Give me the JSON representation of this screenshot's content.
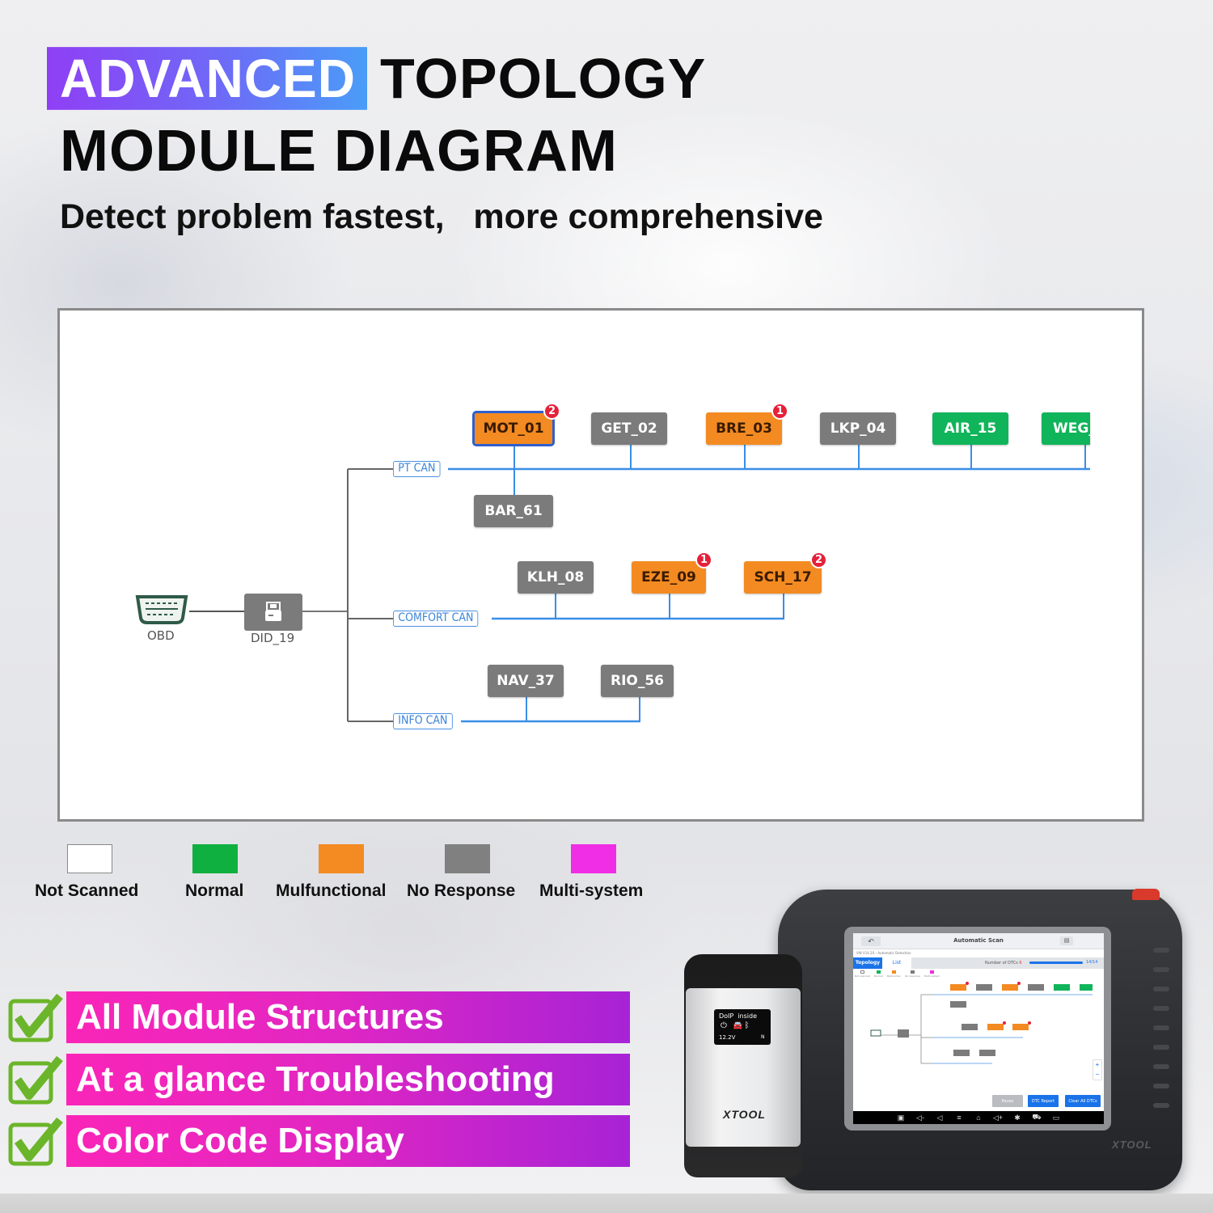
{
  "headline": {
    "highlight": "ADVANCED",
    "line1_rest": "TOPOLOGY",
    "line2": "MODULE DIAGRAM",
    "subtitle": "Detect problem fastest,   more comprehensive"
  },
  "colors": {
    "highlight_gradient": [
      "#8f3ff5",
      "#4a9df8"
    ],
    "not_scanned": "#ffffff",
    "normal": "#10b45a",
    "malfunctional": "#f38b22",
    "no_response": "#7b7b7b",
    "multi_system": "#f02ee6",
    "bus_line": "#3a8ee6",
    "trunk_line": "#666666",
    "dtc_badge": "#e5213a",
    "feature_gradient": [
      "#fa25b8",
      "#a723d6"
    ],
    "check_green": "#6bb52a"
  },
  "diagram": {
    "root": {
      "id": "OBD",
      "icon": "obd-connector-icon"
    },
    "gateway": {
      "id": "DID_19",
      "status": "no_response",
      "icon": "gateway-router-icon"
    },
    "buses": [
      {
        "label": "PT CAN",
        "modules_above": [
          {
            "id": "MOT_01",
            "status": "malfunctional",
            "dtc_count": "2",
            "selected": true
          },
          {
            "id": "GET_02",
            "status": "no_response"
          },
          {
            "id": "BRE_03",
            "status": "malfunctional",
            "dtc_count": "1"
          },
          {
            "id": "LKP_04",
            "status": "no_response"
          },
          {
            "id": "AIR_15",
            "status": "normal"
          },
          {
            "id": "WEG_",
            "status": "normal",
            "truncated": true
          }
        ],
        "modules_below": [
          {
            "id": "BAR_61",
            "status": "no_response",
            "attached_to": "MOT_01"
          }
        ]
      },
      {
        "label": "COMFORT CAN",
        "modules_above": [
          {
            "id": "KLH_08",
            "status": "no_response"
          },
          {
            "id": "EZE_09",
            "status": "malfunctional",
            "dtc_count": "1"
          },
          {
            "id": "SCH_17",
            "status": "malfunctional",
            "dtc_count": "2"
          }
        ]
      },
      {
        "label": "INFO CAN",
        "modules_above": [
          {
            "id": "NAV_37",
            "status": "no_response"
          },
          {
            "id": "RIO_56",
            "status": "no_response"
          }
        ]
      }
    ]
  },
  "legend": [
    {
      "label": "Not Scanned",
      "color_key": "not_scanned"
    },
    {
      "label": "Normal",
      "color_key": "normal"
    },
    {
      "label": "Mulfunctional",
      "color_key": "malfunctional"
    },
    {
      "label": "No Response",
      "color_key": "no_response"
    },
    {
      "label": "Multi-system",
      "color_key": "multi_system"
    }
  ],
  "features": [
    {
      "label": "All Module Structures",
      "icon": "checkbox-checked-icon"
    },
    {
      "label": "At a glance Troubleshooting",
      "icon": "checkbox-checked-icon"
    },
    {
      "label": "Color Code Display",
      "icon": "checkbox-checked-icon"
    }
  ],
  "device": {
    "tablet_brand": "XTOOL",
    "screen": {
      "title": "Automatic Scan",
      "back_icon": "↶",
      "breadcrumb": "VW V14.20 › Automatic Detection",
      "tabs": [
        "Topology",
        "List"
      ],
      "active_tab": "Topology",
      "dtc_label": "Number of DTCs",
      "dtc_count": "6",
      "progress_done": 14,
      "progress_total": 14,
      "progress_text": "14/14",
      "legend": [
        "Not scanned",
        "Normal",
        "Malfunction",
        "No response",
        "Multi-system"
      ],
      "buttons": [
        "Pause",
        "DTC Report",
        "Clear All DTCs"
      ],
      "zoom_in": "+",
      "zoom_out": "−",
      "nav_icons": [
        "screenshot-icon",
        "volume-down-icon",
        "back-icon",
        "menu-icon",
        "home-icon",
        "volume-up-icon",
        "settings-icon",
        "car-icon",
        "record-icon"
      ]
    },
    "vci": {
      "line1": "DoIP  inside",
      "voltage": "12.2V",
      "mode": "N",
      "brand": "XTOOL"
    }
  }
}
